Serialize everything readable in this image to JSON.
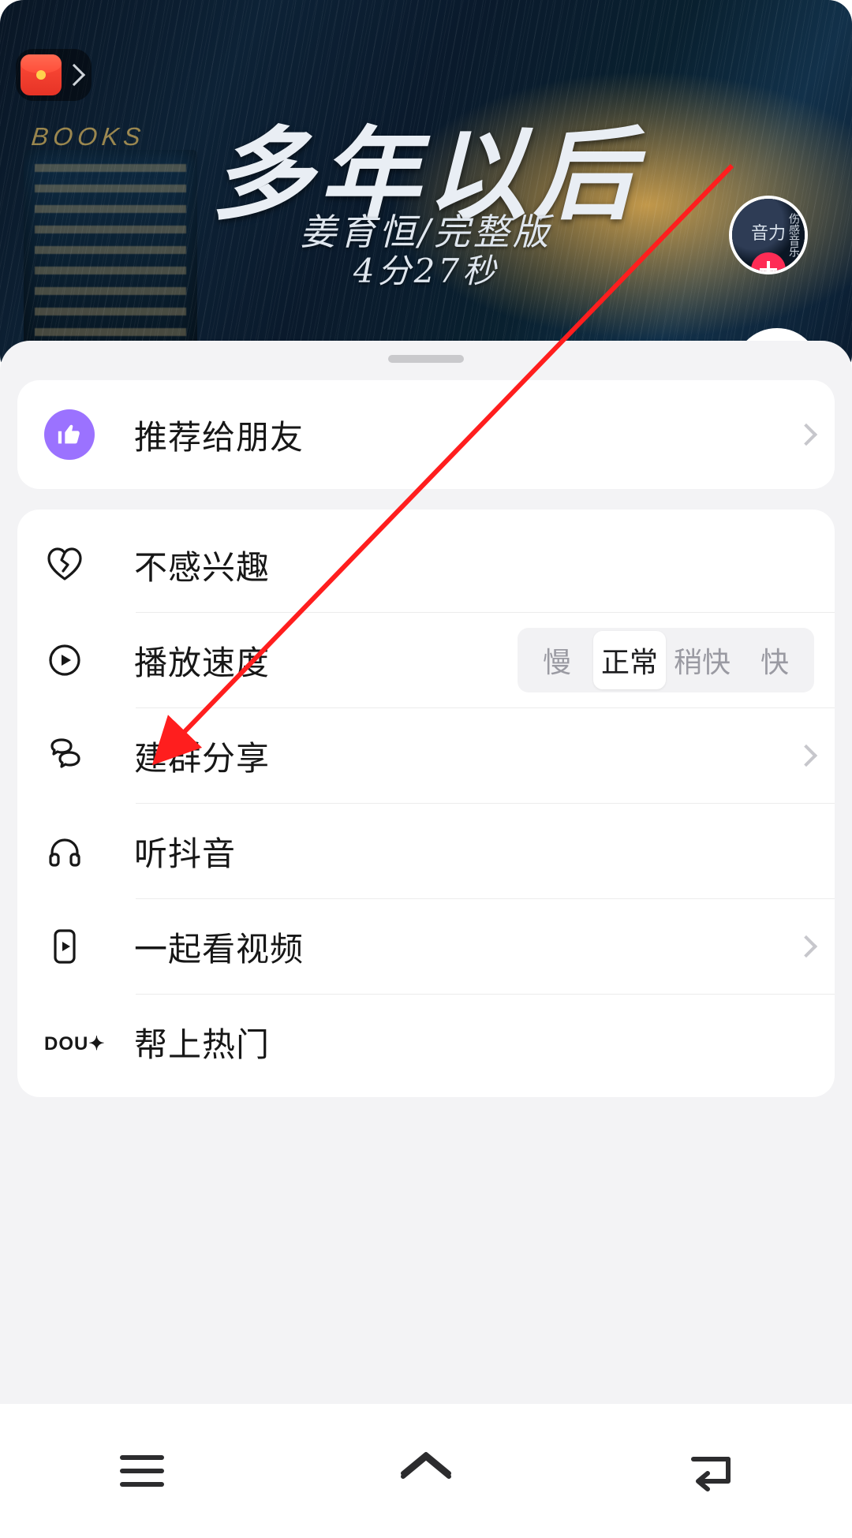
{
  "video": {
    "title": "多年以后",
    "subtitle": "姜育恒/完整版",
    "duration": "4分27秒",
    "neon_sign": "BOOKS"
  },
  "avatar": {
    "main_text": "音力",
    "side_text": "伤感音乐"
  },
  "sheet": {
    "recommend_label": "推荐给朋友",
    "not_interested_label": "不感兴趣",
    "playback_speed_label": "播放速度",
    "speed_options": {
      "slow": "慢",
      "normal": "正常",
      "little_fast": "稍快",
      "fast": "快"
    },
    "group_share_label": "建群分享",
    "listen_douyin_label": "听抖音",
    "watch_together_label": "一起看视频",
    "boost_hot_label": "帮上热门",
    "dou_icon_text": "DOU✦"
  }
}
